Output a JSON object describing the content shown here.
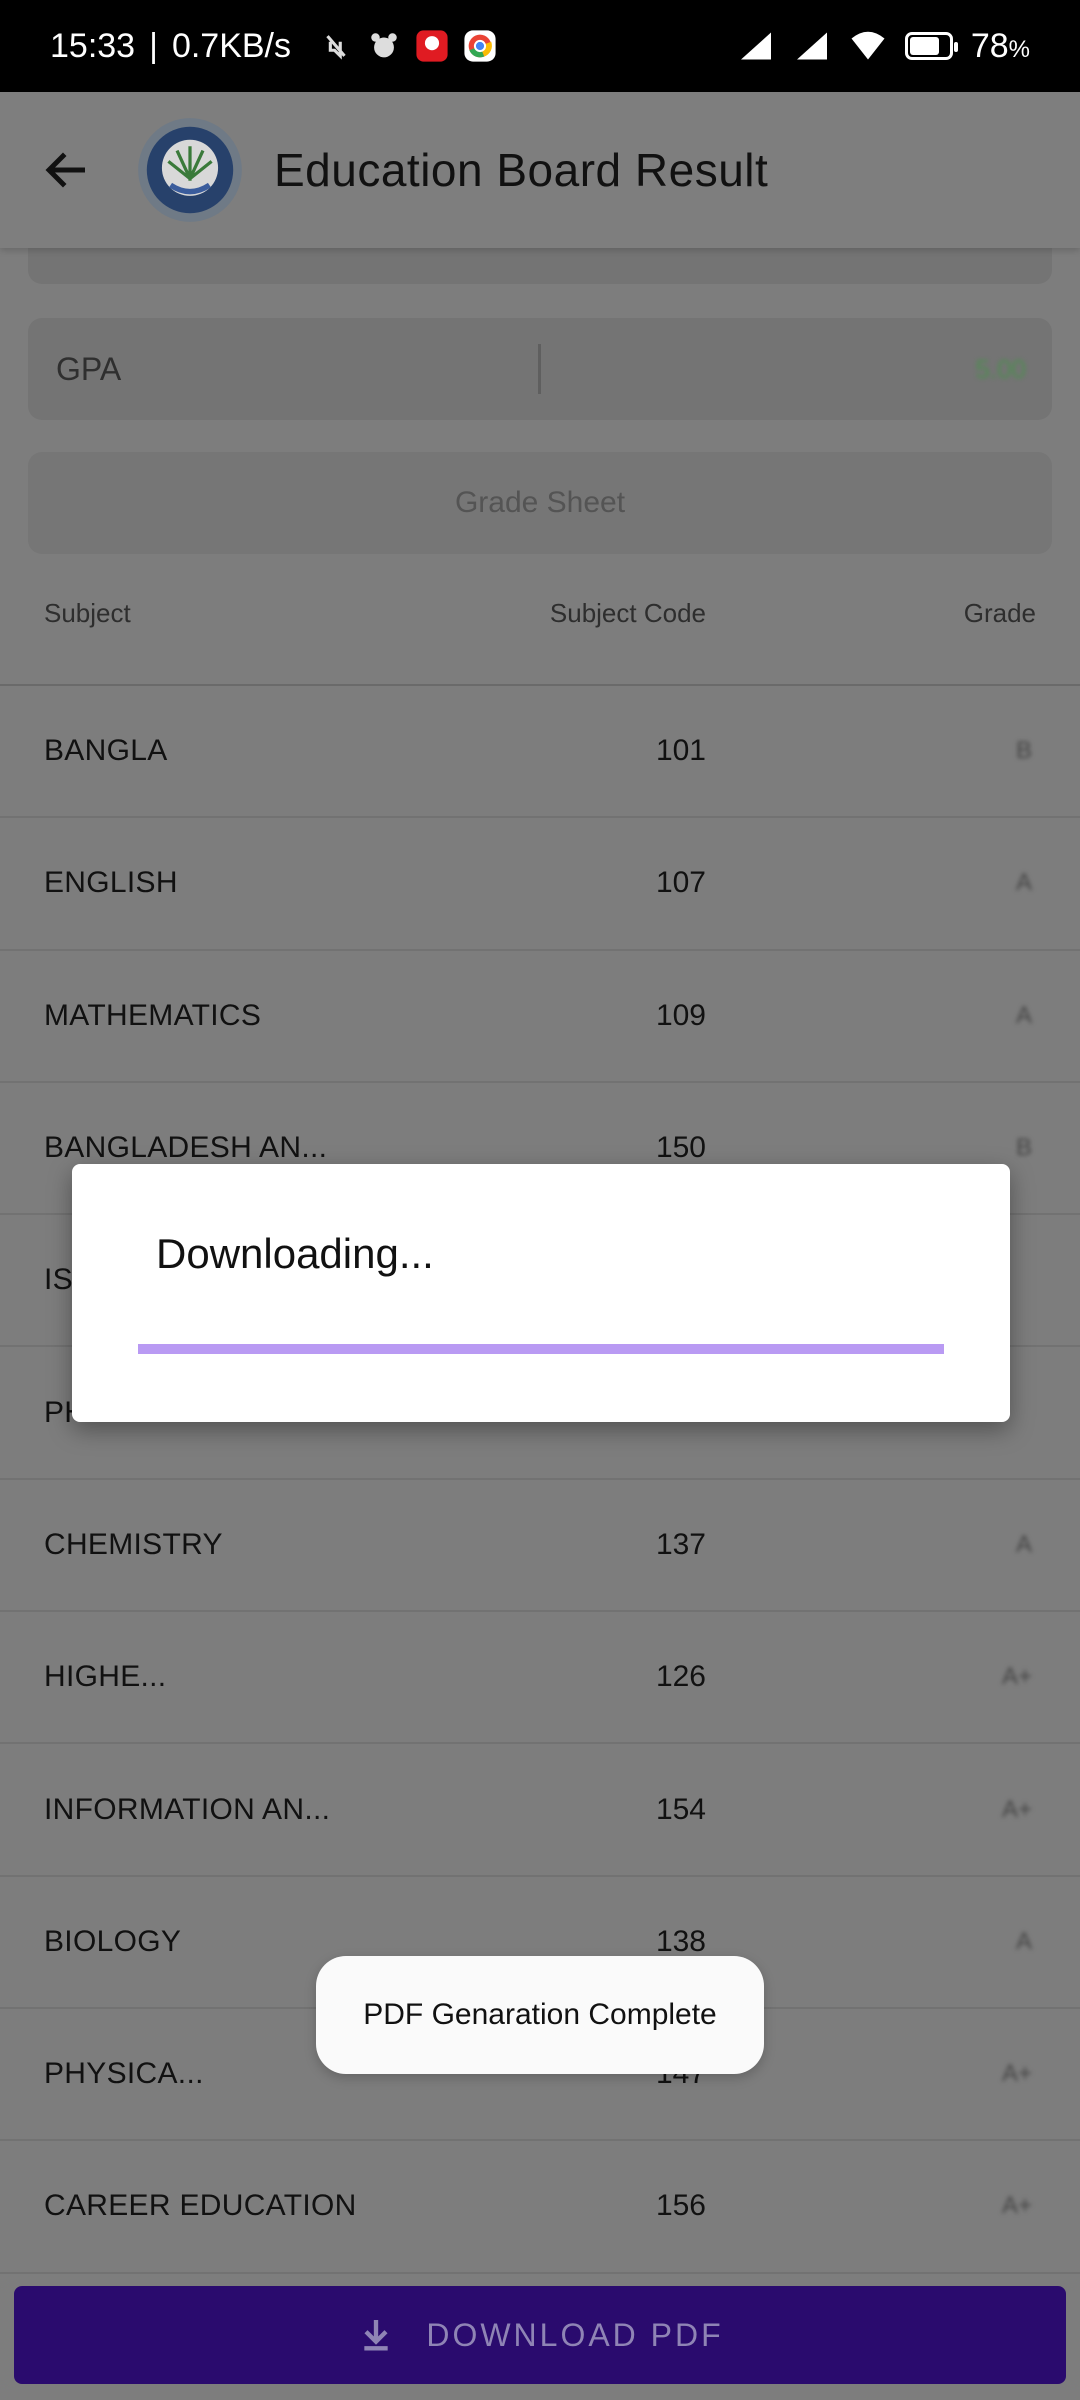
{
  "status_bar": {
    "time": "15:33",
    "network_speed": "0.7KB/s",
    "battery_percent": "78",
    "battery_level": 0.78,
    "notification_icons": [
      "silent-icon",
      "cat-app-icon",
      "airtel-icon",
      "chrome-icon"
    ]
  },
  "app_bar": {
    "title": "Education Board Result",
    "back_icon": "arrow-back-icon",
    "logo_icon": "education-board-logo"
  },
  "result_fields": {
    "gpa_label": "GPA",
    "gpa_value": "5.00"
  },
  "grade_sheet_label": "Grade Sheet",
  "table": {
    "headers": {
      "subject": "Subject",
      "code": "Subject Code",
      "grade": "Grade"
    },
    "rows": [
      {
        "subject": "BANGLA",
        "code": "101",
        "grade": "B"
      },
      {
        "subject": "ENGLISH",
        "code": "107",
        "grade": "A"
      },
      {
        "subject": "MATHEMATICS",
        "code": "109",
        "grade": "A"
      },
      {
        "subject": "BANGLADESH AN...",
        "code": "150",
        "grade": "B"
      },
      {
        "subject": "IS",
        "code": "",
        "grade": ""
      },
      {
        "subject": "PH",
        "code": "",
        "grade": ""
      },
      {
        "subject": "CHEMISTRY",
        "code": "137",
        "grade": "A"
      },
      {
        "subject": "HIGHE...",
        "code": "126",
        "grade": "A+"
      },
      {
        "subject": "INFORMATION AN...",
        "code": "154",
        "grade": "A+"
      },
      {
        "subject": "BIOLOGY",
        "code": "138",
        "grade": "A"
      },
      {
        "subject": "PHYSICA...",
        "code": "147",
        "grade": "A+"
      },
      {
        "subject": "CAREER EDUCATION",
        "code": "156",
        "grade": "A+"
      }
    ]
  },
  "download_button": {
    "label": "DOWNLOAD PDF",
    "icon": "download-icon"
  },
  "dialog": {
    "title": "Downloading...",
    "progress": 1.0,
    "accent_color": "#b99af3"
  },
  "toast": {
    "message": "PDF Genaration Complete"
  },
  "colors": {
    "primary": "#2a0b6e",
    "overlay": "#7d7d7d"
  }
}
